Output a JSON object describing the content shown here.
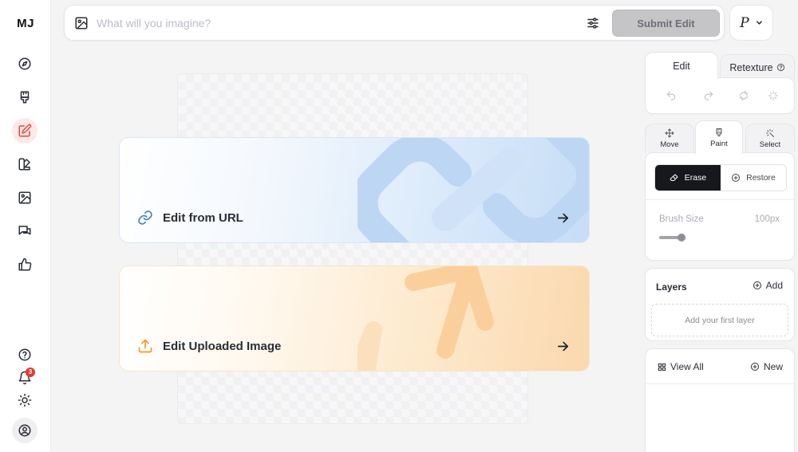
{
  "sidebar": {
    "logo": "MJ",
    "items": [
      {
        "name": "explore",
        "icon": "compass-icon"
      },
      {
        "name": "create",
        "icon": "paintbrush-icon"
      },
      {
        "name": "edit",
        "icon": "edit-icon",
        "active": true
      },
      {
        "name": "personalize",
        "icon": "palette-icon"
      },
      {
        "name": "organize",
        "icon": "image-icon"
      },
      {
        "name": "chat",
        "icon": "chat-icon"
      },
      {
        "name": "tasks",
        "icon": "thumbs-up-icon"
      }
    ],
    "bottom_items": [
      {
        "name": "help",
        "icon": "help-icon"
      },
      {
        "name": "notifications",
        "icon": "bell-icon",
        "badge": "3"
      },
      {
        "name": "theme",
        "icon": "sun-icon"
      },
      {
        "name": "account",
        "icon": "user-circle-icon"
      }
    ]
  },
  "prompt": {
    "placeholder": "What will you imagine?",
    "value": "",
    "submit_label": "Submit Edit"
  },
  "profile": {
    "initial": "P"
  },
  "cards": {
    "url": {
      "label": "Edit from URL",
      "icon": "link-icon"
    },
    "upload": {
      "label": "Edit Uploaded Image",
      "icon": "upload-icon"
    }
  },
  "right_panel": {
    "tabs": {
      "edit": "Edit",
      "retexture": "Retexture"
    },
    "tools": {
      "move": "Move",
      "paint": "Paint",
      "select": "Select"
    },
    "paint": {
      "erase_label": "Erase",
      "restore_label": "Restore",
      "brush_size_label": "Brush Size",
      "brush_size_value": "100px",
      "brush_level": 0.15
    },
    "layers": {
      "title": "Layers",
      "add_label": "Add",
      "empty_label": "Add your first layer"
    },
    "gallery": {
      "view_all_label": "View All",
      "new_label": "New"
    }
  },
  "colors": {
    "accent": "#e0483c",
    "active_bg": "#fde9e7",
    "erase_bg": "#17181c",
    "submit_disabled": "#c5c5c8"
  }
}
